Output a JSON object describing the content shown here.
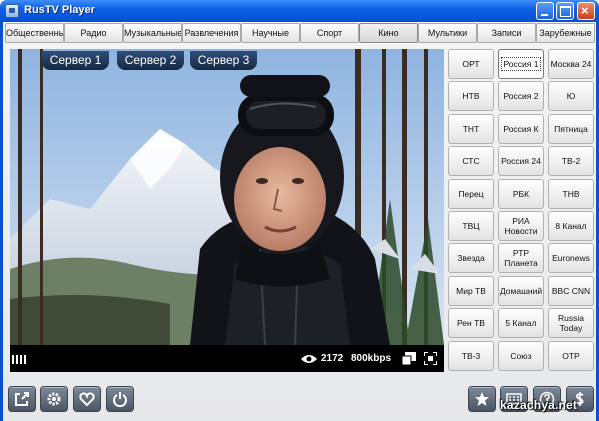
{
  "window": {
    "title": "RusTV Player"
  },
  "categories": [
    "Общественные",
    "Радио",
    "Музыкальные",
    "Развлечения",
    "Научные",
    "Спорт",
    "Кино",
    "Мультики",
    "Записи",
    "Зарубежные"
  ],
  "active_category": "Кино",
  "player": {
    "servers": [
      "Сервер 1",
      "Сервер 2",
      "Сервер 3"
    ],
    "viewers": "2172",
    "bitrate": "800kbps"
  },
  "channels": [
    [
      "ОРТ",
      "Россия 1",
      "Москва 24"
    ],
    [
      "НТВ",
      "Россия 2",
      "Ю"
    ],
    [
      "ТНТ",
      "Россия К",
      "Пятница"
    ],
    [
      "СТС",
      "Россия 24",
      "ТВ-2"
    ],
    [
      "Перец",
      "РБК",
      "ТНВ"
    ],
    [
      "ТВЦ",
      "РИА Новости",
      "8 Канал"
    ],
    [
      "Звезда",
      "РТР Планета",
      "Euronews"
    ],
    [
      "Мир ТВ",
      "Домашний",
      "BBC CNN"
    ],
    [
      "Рен ТВ",
      "5 Канал",
      "Russia Today"
    ],
    [
      "ТВ-3",
      "Союз",
      "ОТР"
    ]
  ],
  "selected_channel": "Россия 1",
  "watermark": "kazachya.net",
  "icons": {
    "toolbar_left": [
      "external-link-icon",
      "gear-icon",
      "heart-icon",
      "power-icon"
    ],
    "toolbar_right": [
      "star-icon",
      "keyboard-icon",
      "help-icon",
      "dollar-icon"
    ]
  }
}
